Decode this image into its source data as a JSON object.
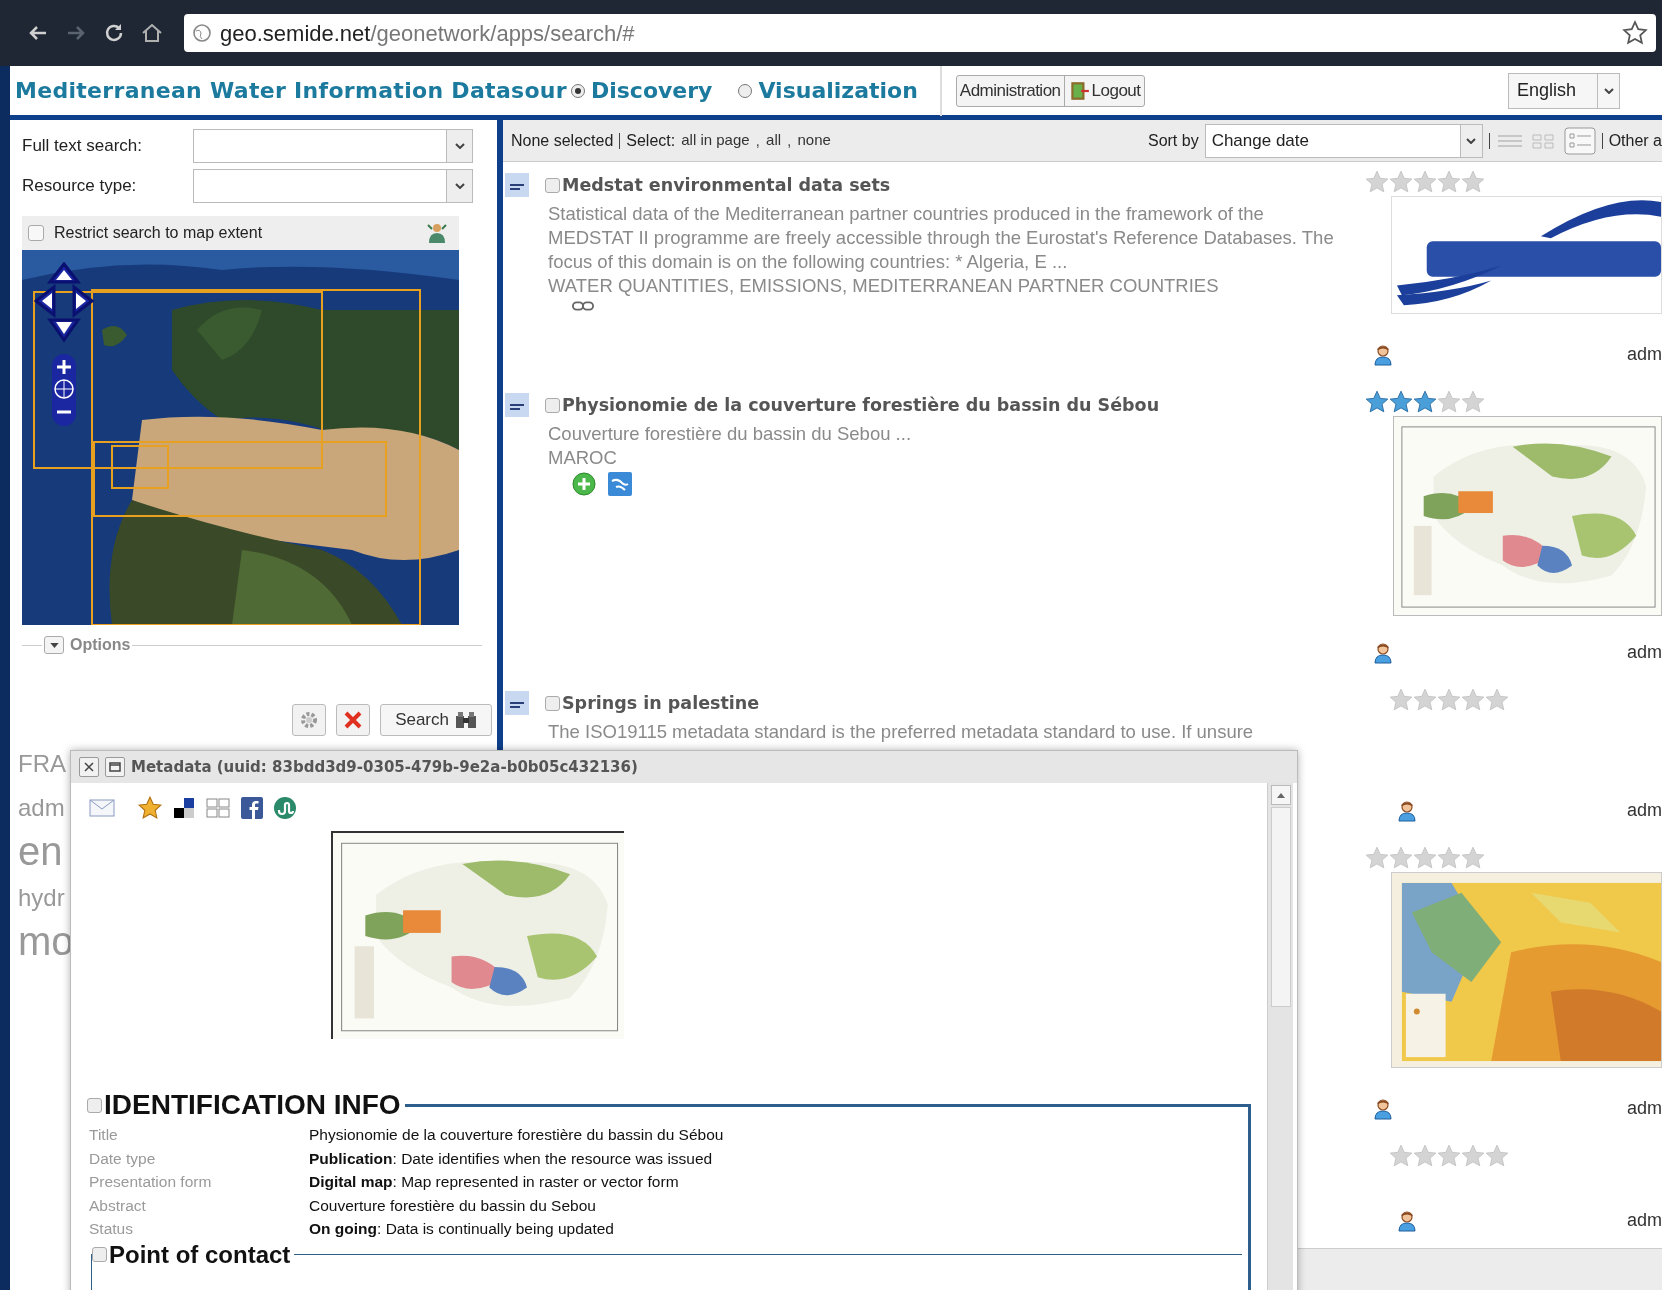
{
  "browser": {
    "url_host": "geo.semide.net",
    "url_path": "/geonetwork/apps/search/#"
  },
  "header": {
    "title": "Mediterranean Water Information Datasour",
    "modes": [
      {
        "label": "Discovery",
        "selected": true
      },
      {
        "label": "Visualization",
        "selected": false
      }
    ],
    "buttons": [
      "Administration",
      "Logout"
    ],
    "language": "English"
  },
  "search": {
    "fields": [
      {
        "label": "Full text search:"
      },
      {
        "label": "Resource type:"
      }
    ],
    "map_restrict": {
      "label": "Restrict search to map extent",
      "checked": false
    },
    "options": "Options",
    "search_button": "Search"
  },
  "tag_cloud": [
    {
      "text": "FRA",
      "kind": "small"
    },
    {
      "text": "adm",
      "kind": "small"
    },
    {
      "text": "en",
      "kind": "large"
    },
    {
      "text": "hydr",
      "kind": "small"
    },
    {
      "text": "mo",
      "kind": "large"
    }
  ],
  "results_toolbar": {
    "selection": "None selected",
    "select_label": "Select:",
    "select_links": [
      {
        "text": "all in page"
      },
      {
        "separator": ",",
        "text": "all"
      },
      {
        "separator": ",",
        "text": "none"
      }
    ],
    "sort_label": "Sort by",
    "sort_value": "Change date",
    "other": "Other a"
  },
  "results": [
    {
      "title": "Medstat environmental data sets",
      "checked": false,
      "abstract": "Statistical data of the Mediterranean partner countries produced in the framework of the MEDSTAT II programme are freely accessible through the Eurostat's Reference Databases. The focus of this domain is on the following countries: * Algeria, E ...",
      "keywords": "WATER QUANTITIES, EMISSIONS, MEDITERRANEAN PARTNER COUNTRIES",
      "links": [
        {
          "kind": "link"
        }
      ],
      "stars": 0,
      "thumbnail": {
        "kind": "logo"
      },
      "owner": "adm"
    },
    {
      "title": "Physionomie de la couverture forestière du bassin du Sébou",
      "checked": false,
      "abstract": "Couverture forestière du bassin du Sebou ...",
      "keywords": "MAROC",
      "links": [
        {
          "kind": "add"
        },
        {
          "kind": "map"
        }
      ],
      "stars": 3,
      "thumbnail": {
        "kind": "forest_map"
      },
      "owner": "adm"
    },
    {
      "title": "Springs in palestine",
      "checked": false,
      "abstract": "The ISO19115 metadata standard is the preferred metadata standard to use. If unsure",
      "stars": 0,
      "owner": "adm"
    },
    {
      "stars": 0,
      "thumbnail": {
        "kind": "relief_map"
      },
      "owner": "adm"
    },
    {
      "stars": 0,
      "owner": "adm"
    }
  ],
  "metadata_window": {
    "title": "Metadata (uuid: 83bdd3d9-0305-479b-9e2a-b0b05c432136)",
    "section": {
      "label": "IDENTIFICATION INFO",
      "checked": false
    },
    "rows": [
      {
        "label": "Title",
        "value": "Physionomie de la couverture forestière du bassin du Sébou"
      },
      {
        "label": "Date type",
        "value": "**Publication**: Date identifies when the resource was issued"
      },
      {
        "label": "Presentation form",
        "value": "**Digital map**: Map represented in raster or vector form"
      },
      {
        "label": "Abstract",
        "value": "Couverture forestière du bassin du Sebou"
      },
      {
        "label": "Status",
        "value": "**On going**: Data is continually being updated"
      }
    ],
    "subsection": {
      "label": "Point of contact",
      "checked": false
    }
  }
}
